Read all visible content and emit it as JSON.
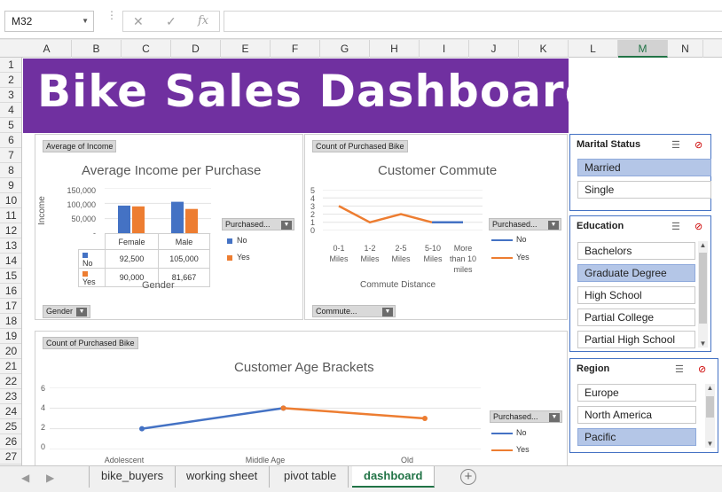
{
  "formula_bar": {
    "name_box": "M32",
    "cancel_icon": "✕",
    "enter_icon": "✓",
    "fx_label": "fx",
    "formula": ""
  },
  "columns": [
    "A",
    "B",
    "C",
    "D",
    "E",
    "F",
    "G",
    "H",
    "I",
    "J",
    "K",
    "L",
    "M",
    "N"
  ],
  "selected_column": "M",
  "rows": [
    "1",
    "2",
    "3",
    "4",
    "5",
    "6",
    "7",
    "8",
    "9",
    "10",
    "11",
    "12",
    "13",
    "14",
    "15",
    "16",
    "17",
    "18",
    "19",
    "20",
    "21",
    "22",
    "23",
    "24",
    "25",
    "26",
    "27"
  ],
  "banner": {
    "title": "Bike Sales Dashboard",
    "color": "#7030a0"
  },
  "income_chart": {
    "field_pill": "Average of Income",
    "title": "Average Income per Purchase",
    "ylabel": "Income",
    "xlabel": "Gender",
    "yticks": [
      "150,000",
      "100,000",
      "50,000",
      "-"
    ],
    "legend_title": "Purchased...",
    "legend": [
      "No",
      "Yes"
    ],
    "axis_pill": "Gender",
    "table": {
      "headers": [
        "Female",
        "Male"
      ],
      "rows": [
        {
          "label": "No",
          "values": [
            "92,500",
            "105,000"
          ]
        },
        {
          "label": "Yes",
          "values": [
            "90,000",
            "81,667"
          ]
        }
      ]
    }
  },
  "commute_chart": {
    "field_pill": "Count of Purchased Bike",
    "title": "Customer Commute",
    "xlabel": "Commute Distance",
    "yticks": [
      "5",
      "4",
      "3",
      "2",
      "1",
      "0"
    ],
    "categories": [
      "0-1 Miles",
      "1-2 Miles",
      "2-5 Miles",
      "5-10 Miles",
      "More than 10 miles"
    ],
    "legend_title": "Purchased...",
    "legend": [
      "No",
      "Yes"
    ],
    "axis_pill": "Commute..."
  },
  "age_chart": {
    "field_pill": "Count of Purchased Bike",
    "title": "Customer Age Brackets",
    "yticks": [
      "6",
      "4",
      "2",
      "0"
    ],
    "categories": [
      "Adolescent",
      "Middle Age",
      "Old"
    ],
    "legend_title": "Purchased...",
    "legend": [
      "No",
      "Yes"
    ]
  },
  "chart_data": [
    {
      "type": "bar",
      "title": "Average Income per Purchase",
      "xlabel": "Gender",
      "ylabel": "Income",
      "categories": [
        "Female",
        "Male"
      ],
      "ylim": [
        0,
        150000
      ],
      "series": [
        {
          "name": "No",
          "values": [
            92500,
            105000
          ],
          "color": "#4472c4"
        },
        {
          "name": "Yes",
          "values": [
            90000,
            81667
          ],
          "color": "#ed7d31"
        }
      ]
    },
    {
      "type": "line",
      "title": "Customer Commute",
      "xlabel": "Commute Distance",
      "categories": [
        "0-1 Miles",
        "1-2 Miles",
        "2-5 Miles",
        "5-10 Miles",
        "More than 10 miles"
      ],
      "ylim": [
        0,
        5
      ],
      "series": [
        {
          "name": "No",
          "values": [
            null,
            null,
            null,
            1,
            1
          ],
          "color": "#4472c4"
        },
        {
          "name": "Yes",
          "values": [
            3,
            1,
            2,
            1,
            null
          ],
          "color": "#ed7d31"
        }
      ]
    },
    {
      "type": "line",
      "title": "Customer Age Brackets",
      "categories": [
        "Adolescent",
        "Middle Age",
        "Old"
      ],
      "ylim": [
        0,
        6
      ],
      "series": [
        {
          "name": "No",
          "values": [
            2,
            4,
            null
          ],
          "color": "#4472c4"
        },
        {
          "name": "Yes",
          "values": [
            null,
            4,
            3
          ],
          "color": "#ed7d31"
        }
      ]
    }
  ],
  "slicers": {
    "marital": {
      "title": "Marital Status",
      "items": [
        {
          "label": "Married",
          "selected": true
        },
        {
          "label": "Single",
          "selected": false
        }
      ]
    },
    "education": {
      "title": "Education",
      "items": [
        {
          "label": "Bachelors",
          "selected": false
        },
        {
          "label": "Graduate Degree",
          "selected": true
        },
        {
          "label": "High School",
          "selected": false
        },
        {
          "label": "Partial College",
          "selected": false
        },
        {
          "label": "Partial High School",
          "selected": false
        }
      ]
    },
    "region": {
      "title": "Region",
      "items": [
        {
          "label": "Europe",
          "selected": false
        },
        {
          "label": "North America",
          "selected": false
        },
        {
          "label": "Pacific",
          "selected": true
        }
      ]
    }
  },
  "tabs": [
    {
      "label": "bike_buyers",
      "active": false
    },
    {
      "label": "working sheet",
      "active": false
    },
    {
      "label": "pivot table",
      "active": false
    },
    {
      "label": "dashboard",
      "active": true
    }
  ],
  "add_sheet_icon": "⊕"
}
